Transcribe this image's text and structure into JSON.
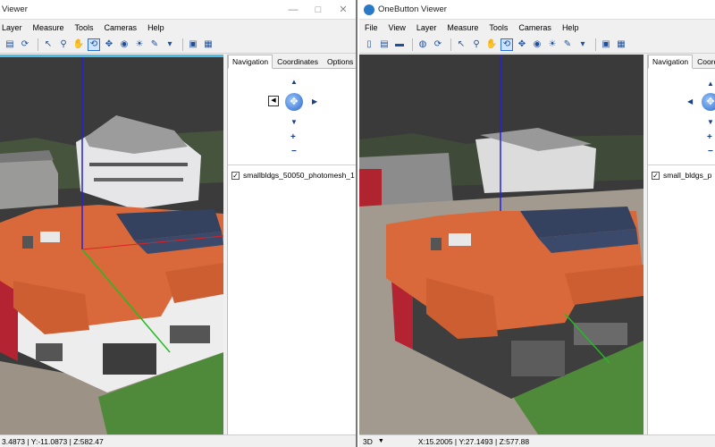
{
  "left_window": {
    "title": "Viewer",
    "controls": [
      "—",
      "□",
      "✕"
    ],
    "menu": [
      "Layer",
      "Measure",
      "Tools",
      "Cameras",
      "Help"
    ],
    "tabs": [
      "Navigation",
      "Coordinates",
      "Options"
    ],
    "layer_name": "smallbldgs_50050_photomesh_1",
    "status_coords": "3.4873 | Y:-11.0873 | Z:582.47"
  },
  "right_window": {
    "title": "OneButton Viewer",
    "menu": [
      "File",
      "View",
      "Layer",
      "Measure",
      "Tools",
      "Cameras",
      "Help"
    ],
    "tabs": [
      "Navigation",
      "Coordi"
    ],
    "layer_name": "small_bldgs_p",
    "status_mode": "3D",
    "status_coords": "X:15.2005 | Y:27.1493 | Z:577.88"
  },
  "icons": {
    "toolbar_left": [
      "folder-icon",
      "refresh-icon",
      "pointer-icon",
      "zoom-icon",
      "pan-hand-icon",
      "orbit-icon",
      "move-icon",
      "eye-icon",
      "light-icon",
      "measure-icon",
      "camera-icon",
      "layers-icon"
    ],
    "toolbar_right": [
      "new-file-icon",
      "open-folder-icon",
      "save-icon",
      "globe-icon",
      "refresh-icon",
      "pointer-icon",
      "zoom-icon",
      "pan-hand-icon",
      "orbit-icon",
      "move-icon",
      "eye-icon",
      "light-icon",
      "measure-icon",
      "camera-icon",
      "layers-icon"
    ]
  },
  "colors": {
    "accent": "#45c0e8",
    "axis_z": "#2222dd",
    "axis_x": "#dd2222",
    "axis_y": "#22bb22",
    "roof": "#d9693a",
    "solar": "#34425f",
    "grass": "#4f8a3a",
    "sky": "#3a3a3a"
  }
}
